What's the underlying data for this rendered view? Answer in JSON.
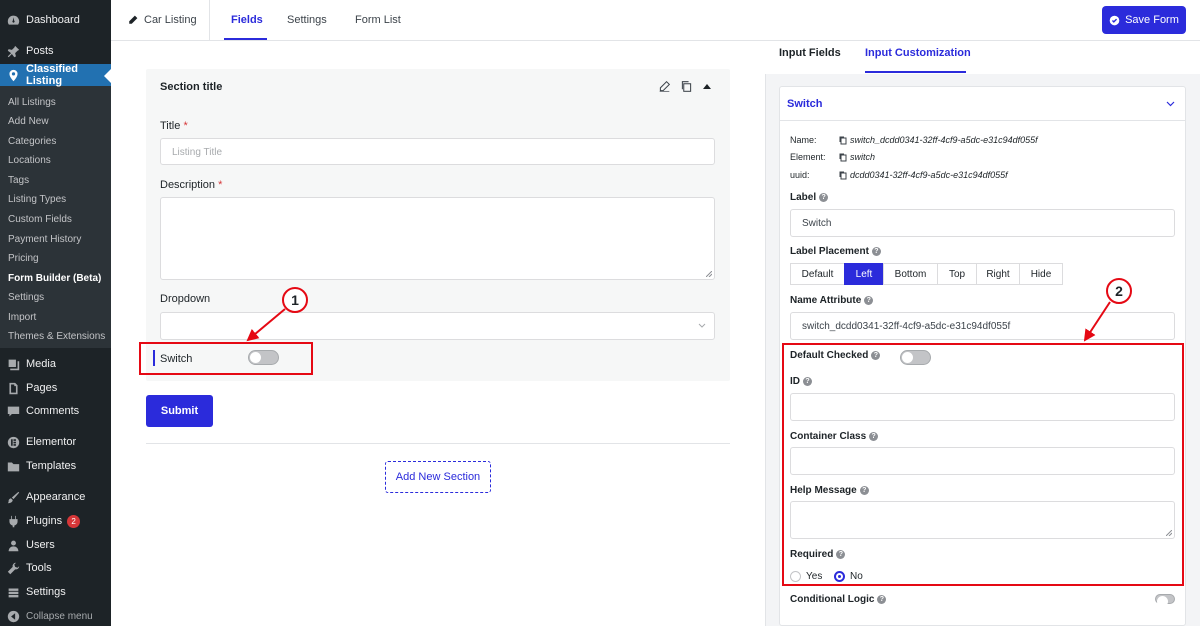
{
  "sidebar": {
    "dashboard": "Dashboard",
    "posts": "Posts",
    "classified": "Classified Listing",
    "sub": [
      "All Listings",
      "Add New",
      "Categories",
      "Locations",
      "Tags",
      "Listing Types",
      "Custom Fields",
      "Payment History",
      "Pricing",
      "Form Builder (Beta)",
      "Settings",
      "Import",
      "Themes & Extensions"
    ],
    "media": "Media",
    "pages": "Pages",
    "comments": "Comments",
    "elementor": "Elementor",
    "templates": "Templates",
    "appearance": "Appearance",
    "plugins": "Plugins",
    "plugins_badge": "2",
    "users": "Users",
    "tools": "Tools",
    "settings": "Settings",
    "collapse": "Collapse menu"
  },
  "topbar": {
    "form_name": "Car Listing",
    "tabs": [
      "Fields",
      "Settings",
      "Form List"
    ],
    "save": "Save Form"
  },
  "builder": {
    "section_title": "Section title",
    "title_label": "Title",
    "title_placeholder": "Listing Title",
    "description_label": "Description",
    "dropdown_label": "Dropdown",
    "switch_label": "Switch",
    "submit": "Submit",
    "add_section": "Add New Section"
  },
  "panel": {
    "tabs": [
      "Input Fields",
      "Input Customization"
    ],
    "card_title": "Switch",
    "name_key": "Name:",
    "name_val": "switch_dcdd0341-32ff-4cf9-a5dc-e31c94df055f",
    "element_key": "Element:",
    "element_val": "switch",
    "uuid_key": "uuid:",
    "uuid_val": "dcdd0341-32ff-4cf9-a5dc-e31c94df055f",
    "label_label": "Label",
    "label_value": "Switch",
    "placement_label": "Label Placement",
    "placements": [
      "Default",
      "Left",
      "Bottom",
      "Top",
      "Right",
      "Hide"
    ],
    "name_attr_label": "Name Attribute",
    "name_attr_value": "switch_dcdd0341-32ff-4cf9-a5dc-e31c94df055f",
    "default_checked": "Default Checked",
    "id_label": "ID",
    "container_class": "Container Class",
    "help_message": "Help Message",
    "required": "Required",
    "yes": "Yes",
    "no": "No",
    "conditional": "Conditional Logic"
  },
  "callouts": [
    "1",
    "2"
  ],
  "colors": {
    "accent": "#2b2bdb",
    "annotation": "#e50914",
    "sidebar": "#1d2327",
    "active": "#2271b1"
  }
}
